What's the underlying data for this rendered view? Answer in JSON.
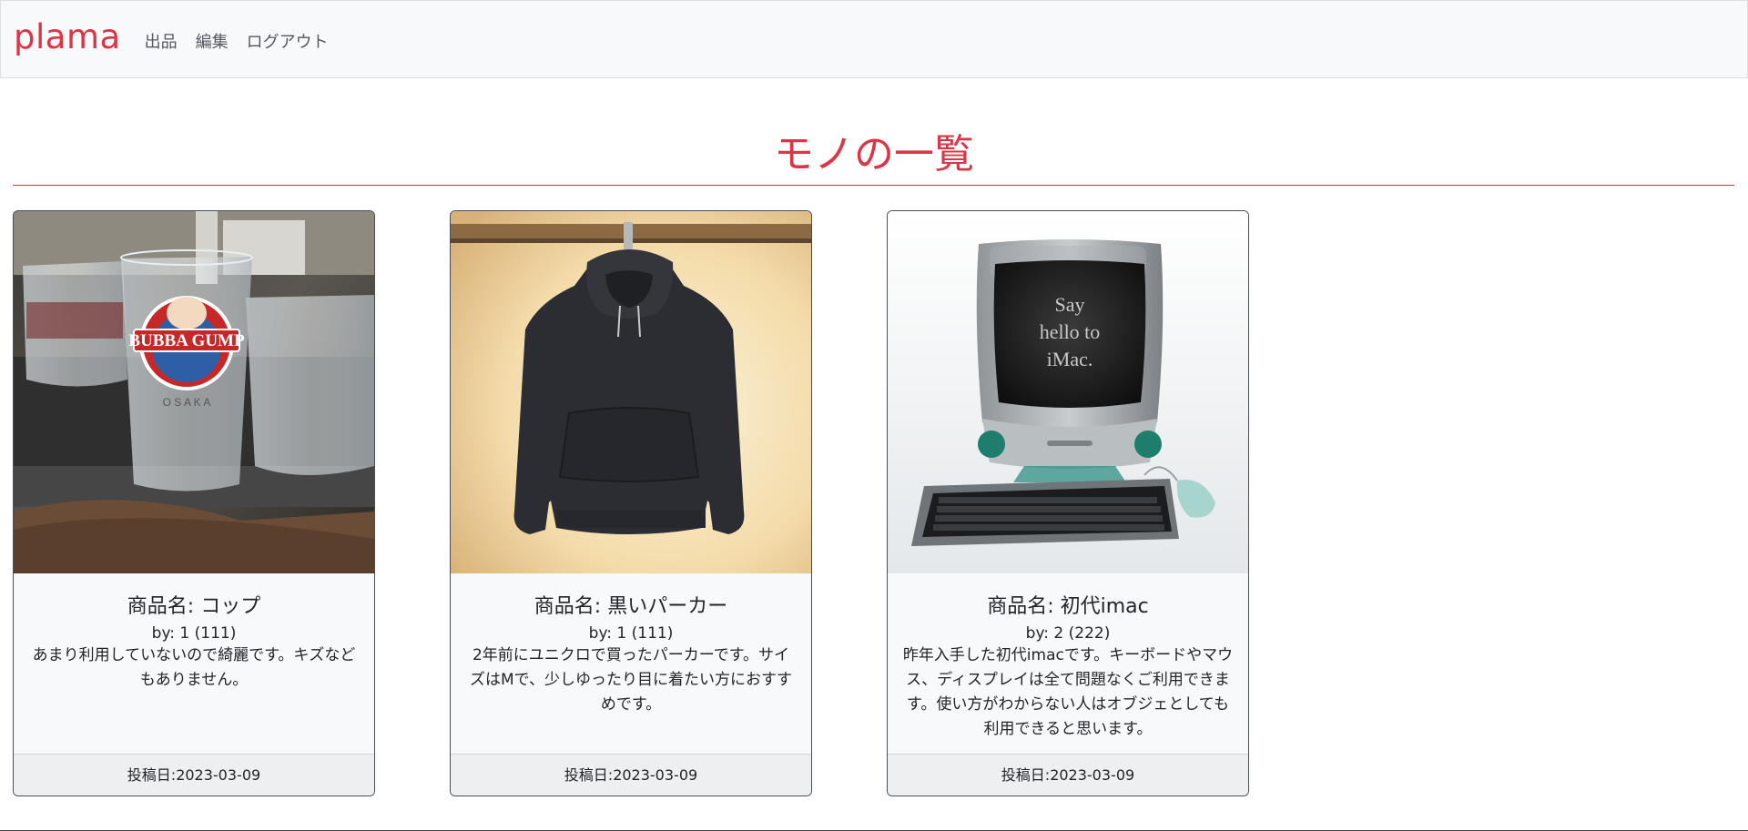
{
  "nav": {
    "brand": "plama",
    "links": [
      "出品",
      "編集",
      "ログアウト"
    ]
  },
  "page": {
    "title": "モノの一覧"
  },
  "items": [
    {
      "title": "商品名: コップ",
      "by": "by: 1 (111)",
      "description": "あまり利用していないので綺麗です。キズなどもありません。",
      "footer": "投稿日:2023-03-09",
      "image_label": "BUBBA GUMP"
    },
    {
      "title": "商品名: 黒いパーカー",
      "by": "by: 1 (111)",
      "description": "2年前にユニクロで買ったパーカーです。サイズはMで、少しゆったり目に着たい方におすすめです。",
      "footer": "投稿日:2023-03-09"
    },
    {
      "title": "商品名: 初代imac",
      "by": "by: 2 (222)",
      "description": "昨年入手した初代imacです。キーボードやマウス、ディスプレイは全て問題なくご利用できます。使い方がわからない人はオブジェとしても利用できると思います。",
      "footer": "投稿日:2023-03-09",
      "image_lines": [
        "Say",
        "hello to",
        "iMac."
      ]
    }
  ],
  "colors": {
    "brand": "#dc3545",
    "navbar_bg": "#f8f9fa",
    "card_border": "#4a4f55"
  }
}
